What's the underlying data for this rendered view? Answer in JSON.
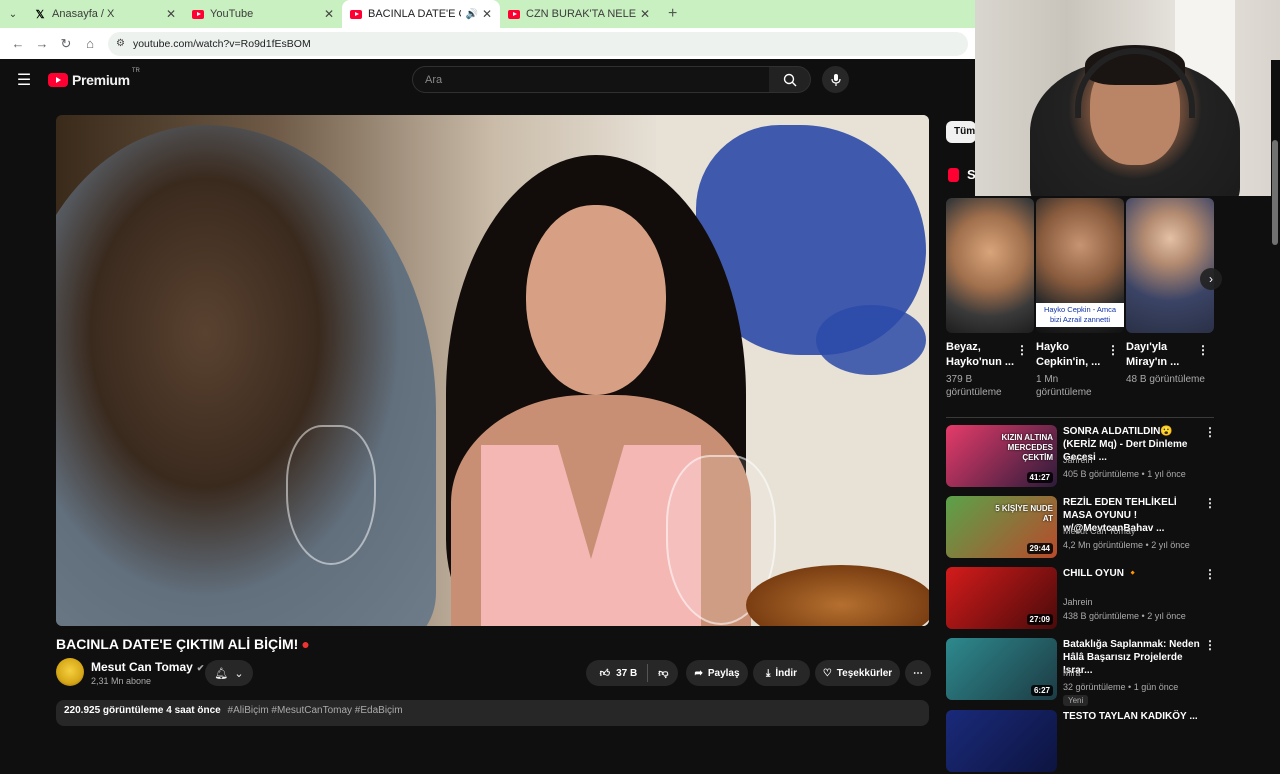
{
  "browser": {
    "tabs": [
      {
        "title": "Anasayfa / X",
        "icon": "x-logo-icon"
      },
      {
        "title": "YouTube",
        "icon": "youtube-icon"
      },
      {
        "title": "BACINLA DATE'E ÇIKTIM ALİ",
        "icon": "youtube-icon",
        "active": true,
        "audio": true
      },
      {
        "title": "CZN BURAK'TA NELER OLUYOR",
        "icon": "youtube-icon"
      }
    ],
    "url": "youtube.com/watch?v=Ro9d1fEsBOM"
  },
  "header": {
    "logo_text": "Premium",
    "logo_region": "TR",
    "search_placeholder": "Ara"
  },
  "video": {
    "title": "BACINLA DATE'E ÇIKTIM ALİ BİÇİM!",
    "channel": "Mesut Can Tomay",
    "subscribers": "2,31 Mn abone",
    "likes": "37 B",
    "share": "Paylaş",
    "download": "İndir",
    "thanks": "Teşekkürler",
    "views": "220.925 görüntüleme",
    "age": "4 saat önce",
    "hashtags": "#AliBiçim #MesutCanTomay #EdaBiçim"
  },
  "sidebar": {
    "chip": "Tümü",
    "shorts_title": "S",
    "shorts": [
      {
        "title": "Beyaz, Hayko'nun ...",
        "views": "379 B görüntüleme"
      },
      {
        "title": "Hayko Cepkin'in, ...",
        "views": "1 Mn görüntüleme",
        "caption": "Hayko Cepkin - Amca bizi Azrail zannetti"
      },
      {
        "title": "Dayı'yla Miray'ın ...",
        "views": "48 B görüntüleme"
      }
    ],
    "recommendations": [
      {
        "title": "SONRA ALDATILDIN😮(KERİZ Mq) - Dert Dinleme Gecesi ...",
        "channel": "Jahrein",
        "meta": "405 B görüntüleme • 1 yıl önce",
        "duration": "41:27",
        "thumb_colors": [
          "#e63b6a",
          "#2b1b3a"
        ],
        "thumb_text": "KIZIN ALTINA MERCEDES ÇEKTİM"
      },
      {
        "title": "REZİL EDEN TEHLİKELİ MASA OYUNU ! w/@MevtcanBahav ...",
        "channel": "Mesut Can Tomay",
        "meta": "4,2 Mn görüntüleme • 2 yıl önce",
        "duration": "29:44",
        "thumb_colors": [
          "#5aa34a",
          "#b84a2b"
        ],
        "thumb_text": "5 KİŞİYE NUDE AT"
      },
      {
        "title": "CHILL OYUN 🔸",
        "channel": "Jahrein",
        "meta": "438 B görüntüleme • 2 yıl önce",
        "duration": "27:09",
        "thumb_colors": [
          "#d41b1b",
          "#4a0a0a"
        ],
        "thumb_text": ""
      },
      {
        "title": "Bataklığa Saplanmak: Neden Hâlâ Başarısız Projelerde Israr...",
        "channel": "Mira",
        "meta": "32 görüntüleme • 1 gün önce",
        "duration": "6:27",
        "thumb_colors": [
          "#2d8a8e",
          "#1d3b44"
        ],
        "thumb_text": "",
        "badge": "Yeni"
      },
      {
        "title": "TESTO TAYLAN KADIKÖY ...",
        "channel": "",
        "meta": "",
        "duration": "",
        "thumb_colors": [
          "#1a2a7a",
          "#0d1440"
        ],
        "thumb_text": ""
      }
    ]
  },
  "colors": {
    "accent": "#ff0033",
    "background": "#0f0f0f",
    "pill": "#272727"
  }
}
